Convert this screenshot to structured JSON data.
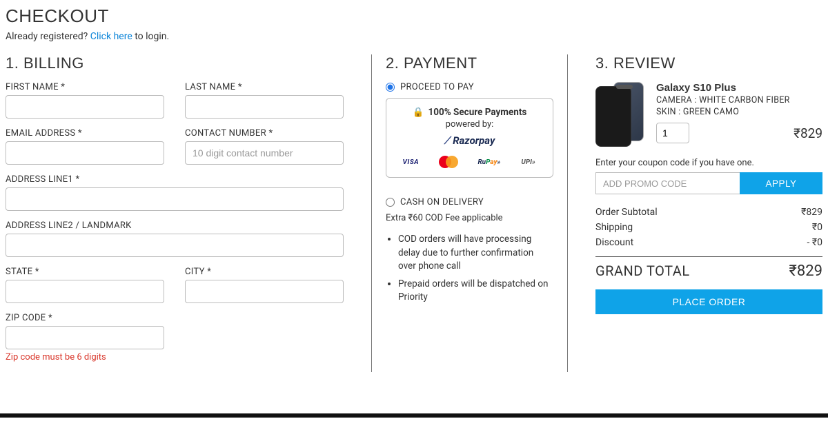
{
  "page": {
    "title": "CHECKOUT",
    "login_prefix": "Already registered? ",
    "login_link": "Click here",
    "login_suffix": " to login."
  },
  "billing": {
    "title": "1. BILLING",
    "first_name_label": "FIRST NAME *",
    "last_name_label": "LAST NAME *",
    "email_label": "EMAIL ADDRESS *",
    "contact_label": "CONTACT NUMBER *",
    "contact_placeholder": "10 digit contact number",
    "addr1_label": "ADDRESS LINE1 *",
    "addr2_label": "ADDRESS LINE2 / LANDMARK",
    "state_label": "STATE *",
    "city_label": "CITY *",
    "zip_label": "ZIP CODE *",
    "zip_error": "Zip code must be 6 digits"
  },
  "payment": {
    "title": "2. PAYMENT",
    "proceed_label": "PROCEED TO PAY",
    "secure_title": "100% Secure Payments",
    "secure_sub": "powered by:",
    "gateway": "Razorpay",
    "cod_label": "CASH ON DELIVERY",
    "cod_note": "Extra ₹60 COD Fee applicable",
    "bullets": [
      "COD orders will have processing delay due to further confirmation over phone call",
      "Prepaid orders will be dispatched on Priority"
    ]
  },
  "review": {
    "title": "3. REVIEW",
    "product": {
      "name": "Galaxy S10 Plus",
      "attr1": "CAMERA : WHITE CARBON FIBER",
      "attr2": "SKIN : GREEN CAMO",
      "qty": "1",
      "price": "₹829"
    },
    "coupon_hint": "Enter your coupon code if you have one.",
    "coupon_placeholder": "ADD PROMO CODE",
    "apply_label": "APPLY",
    "summary": {
      "subtotal_label": "Order Subtotal",
      "subtotal_value": "₹829",
      "shipping_label": "Shipping",
      "shipping_value": "₹0",
      "discount_label": "Discount",
      "discount_value": "- ₹0"
    },
    "grand_label": "GRAND TOTAL",
    "grand_value": "₹829",
    "place_order": "PLACE ORDER"
  }
}
